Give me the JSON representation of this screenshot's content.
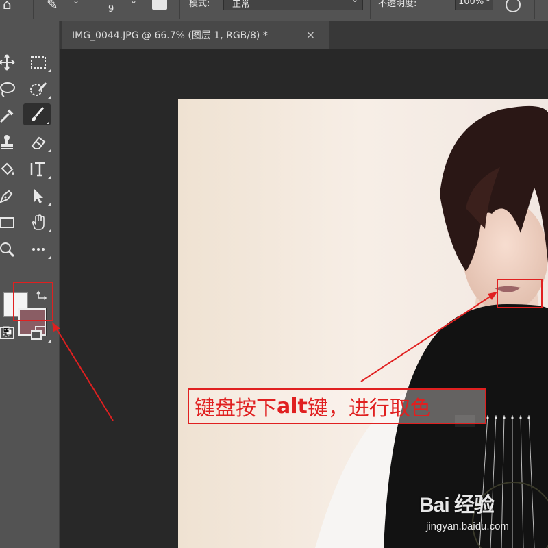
{
  "options_bar": {
    "brush_size": "9",
    "mode_label": "模式:",
    "mode_value": "正常",
    "opacity_label": "不透明度:",
    "opacity_value": "100%"
  },
  "toolbox": {
    "foreground_color": "#f4f4f4",
    "background_color": "#8a5d64"
  },
  "document": {
    "tab_title": "IMG_0044.JPG @ 66.7% (图层 1, RGB/8) *",
    "tab_close": "×"
  },
  "annotation": {
    "part1": "键盘按下",
    "part2": "alt",
    "part3": "键，进行取色",
    "color": "#e02020"
  },
  "watermark": {
    "logo": "Bai  经验",
    "url": "jingyan.baidu.com"
  }
}
